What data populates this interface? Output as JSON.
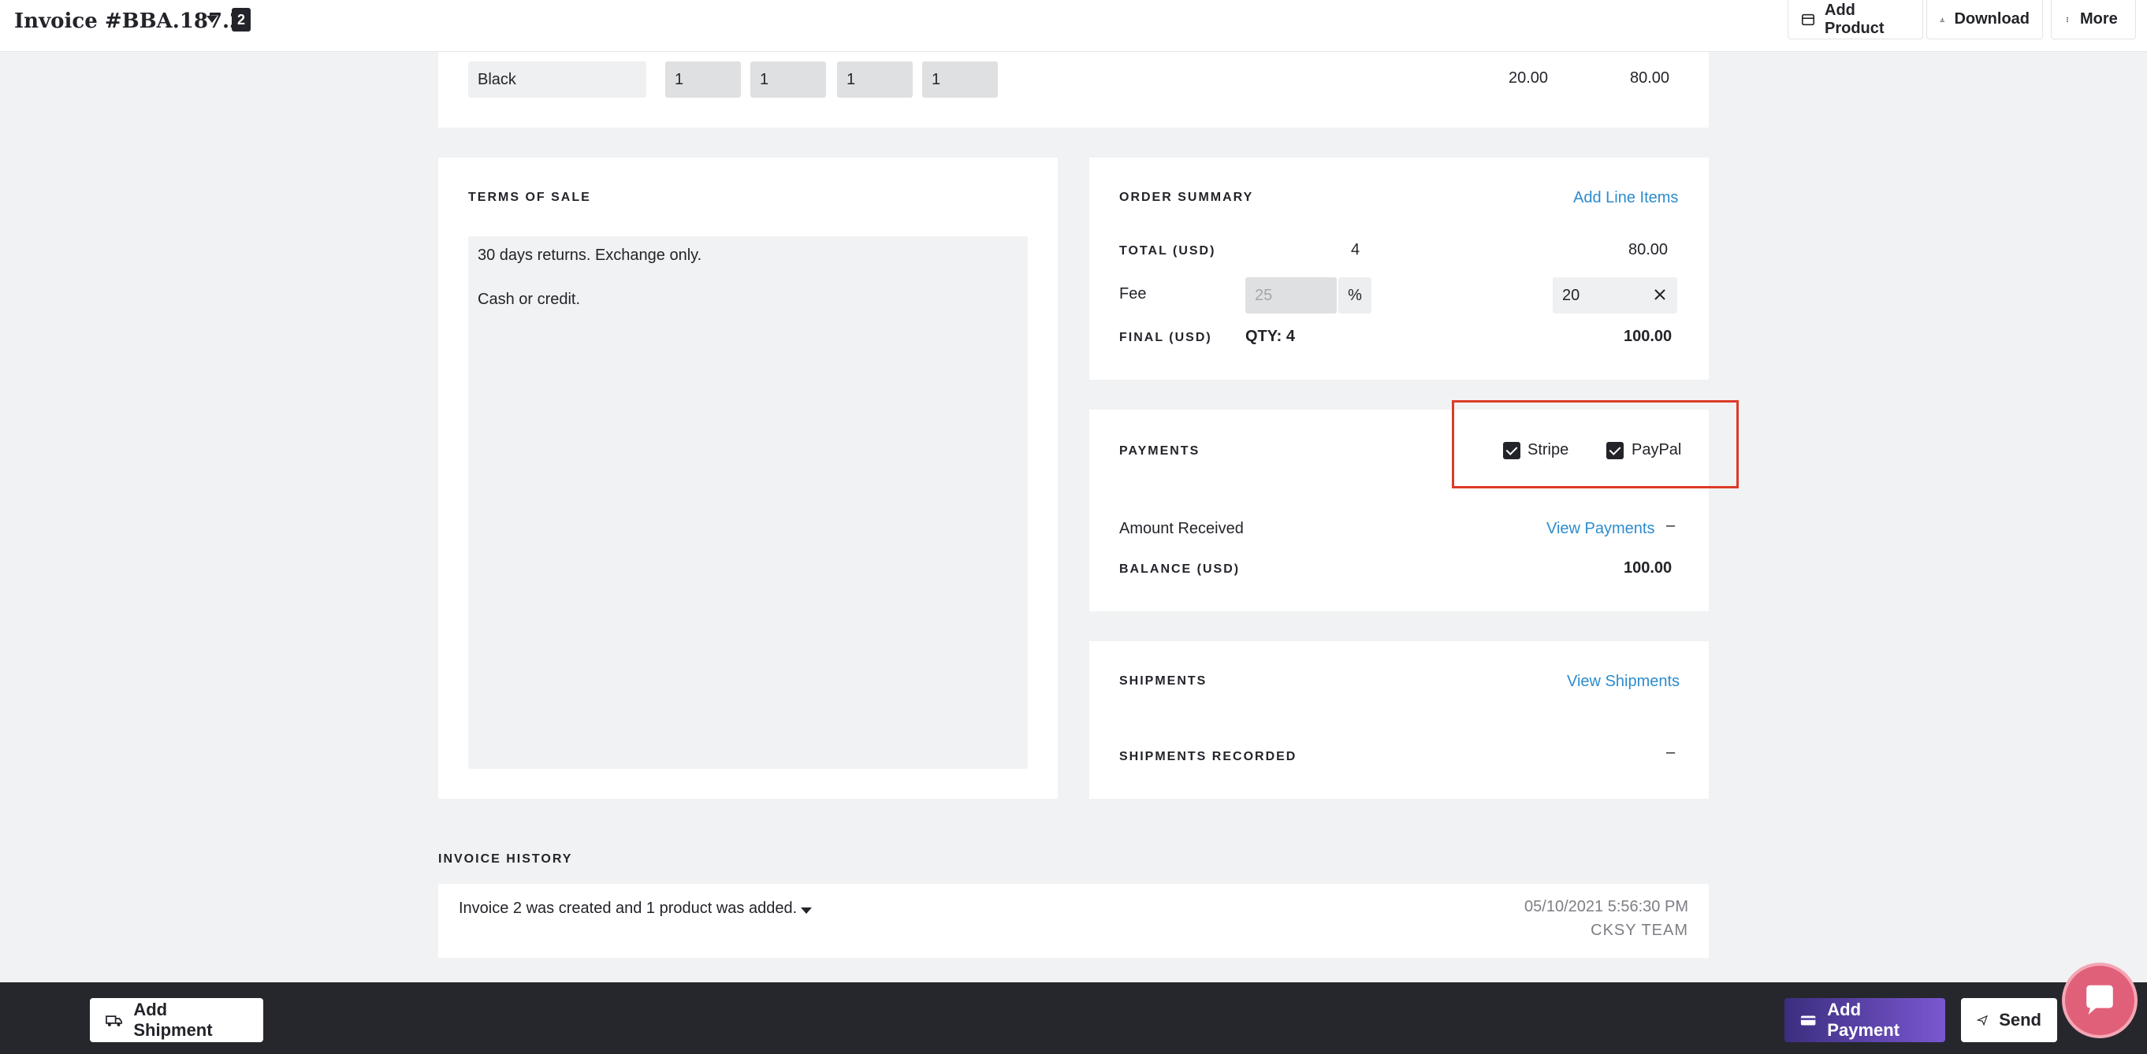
{
  "header": {
    "invoice_title": "Invoice #BBA.187.2",
    "badge": "2",
    "buttons": {
      "add_product": "Add Product",
      "download": "Download",
      "more": "More"
    }
  },
  "line_item": {
    "color": "Black",
    "quantities": [
      "1",
      "1",
      "1",
      "1"
    ],
    "unit_price": "20.00",
    "total": "80.00"
  },
  "terms": {
    "heading": "TERMS OF SALE",
    "line1": "30 days returns. Exchange only.",
    "line2": "Cash or credit."
  },
  "order_summary": {
    "heading": "ORDER SUMMARY",
    "add_line_items": "Add Line Items",
    "total_label": "TOTAL (USD)",
    "total_qty": "4",
    "total_value": "80.00",
    "fee_label": "Fee",
    "fee_percent_placeholder": "25",
    "percent_symbol": "%",
    "fee_value": "20",
    "final_label": "FINAL (USD)",
    "final_qty": "QTY: 4",
    "final_value": "100.00"
  },
  "payments": {
    "heading": "PAYMENTS",
    "methods": [
      {
        "label": "Stripe",
        "checked": true
      },
      {
        "label": "PayPal",
        "checked": true
      }
    ],
    "amount_received_label": "Amount Received",
    "view_payments": "View Payments",
    "amount_received_value": "–",
    "balance_label": "BALANCE (USD)",
    "balance_value": "100.00"
  },
  "shipments": {
    "heading": "SHIPMENTS",
    "view_shipments": "View Shipments",
    "recorded_label": "SHIPMENTS RECORDED",
    "recorded_value": "–"
  },
  "history": {
    "heading": "INVOICE HISTORY",
    "entry_text": "Invoice 2 was created and 1 product was added.",
    "entry_date": "05/10/2021 5:56:30 PM",
    "entry_author": "CKSY TEAM"
  },
  "footer": {
    "add_shipment": "Add Shipment",
    "add_payment": "Add Payment",
    "send": "Send"
  },
  "colors": {
    "accent_link": "#2d8ccd",
    "dark": "#23242a",
    "add_payment_gradient": [
      "#3b2e7e",
      "#7a57d1"
    ],
    "highlight": "#dd3b27",
    "chat": "#e0607a"
  }
}
